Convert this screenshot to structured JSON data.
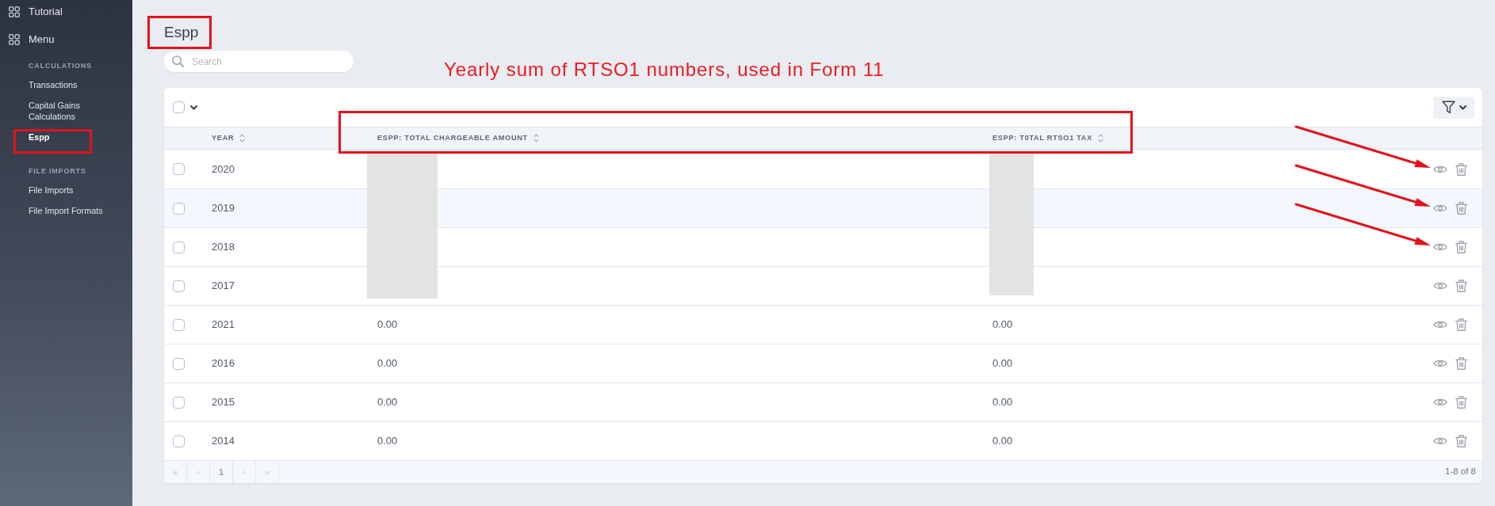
{
  "sidebar": {
    "main_items": [
      {
        "label": "Tutorial"
      },
      {
        "label": "Menu"
      }
    ],
    "sections": [
      {
        "heading": "CALCULATIONS",
        "items": [
          {
            "label": "Transactions",
            "selected": false,
            "boxed": false
          },
          {
            "label": "Capital Gains Calculations",
            "selected": false,
            "boxed": false
          },
          {
            "label": "Espp",
            "selected": true,
            "boxed": true
          }
        ]
      },
      {
        "heading": "FILE IMPORTS",
        "items": [
          {
            "label": "File Imports",
            "selected": false,
            "boxed": false
          },
          {
            "label": "File Import Formats",
            "selected": false,
            "boxed": false
          }
        ]
      }
    ]
  },
  "title": {
    "text": "Espp",
    "boxed": true
  },
  "search": {
    "placeholder": "Search"
  },
  "annotation_text": "Yearly sum of RTSO1 numbers, used in Form 11",
  "table": {
    "select_all_checked": false,
    "columns": [
      {
        "label": "YEAR",
        "boxed": false
      },
      {
        "label": "ESPP: TOTAL CHARGEABLE AMOUNT",
        "boxed": true
      },
      {
        "label": "ESPP: T0TAL RTSO1 TAX",
        "boxed": true
      }
    ],
    "rows": [
      {
        "checked": false,
        "hovered": false,
        "arrow": true,
        "redacted": true,
        "cells": [
          "2020"
        ]
      },
      {
        "checked": false,
        "hovered": true,
        "arrow": true,
        "redacted": true,
        "cells": [
          "2019"
        ]
      },
      {
        "checked": false,
        "hovered": false,
        "arrow": true,
        "redacted": true,
        "cells": [
          "2018"
        ]
      },
      {
        "checked": false,
        "hovered": false,
        "arrow": false,
        "redacted": true,
        "cells": [
          "2017"
        ]
      },
      {
        "checked": false,
        "hovered": false,
        "arrow": false,
        "redacted": false,
        "cells": [
          "2021",
          "0.00",
          "0.00"
        ]
      },
      {
        "checked": false,
        "hovered": false,
        "arrow": false,
        "redacted": false,
        "cells": [
          "2016",
          "0.00",
          "0.00"
        ]
      },
      {
        "checked": false,
        "hovered": false,
        "arrow": false,
        "redacted": false,
        "cells": [
          "2015",
          "0.00",
          "0.00"
        ]
      },
      {
        "checked": false,
        "hovered": false,
        "arrow": false,
        "redacted": false,
        "cells": [
          "2014",
          "0.00",
          "0.00"
        ]
      }
    ]
  },
  "pagination": {
    "buttons": [
      {
        "label": "«",
        "disabled": true
      },
      {
        "label": "‹",
        "disabled": true
      },
      {
        "label": "1",
        "disabled": false
      },
      {
        "label": "›",
        "disabled": true
      },
      {
        "label": "»",
        "disabled": true
      }
    ],
    "summary": "1-8 of 8"
  }
}
